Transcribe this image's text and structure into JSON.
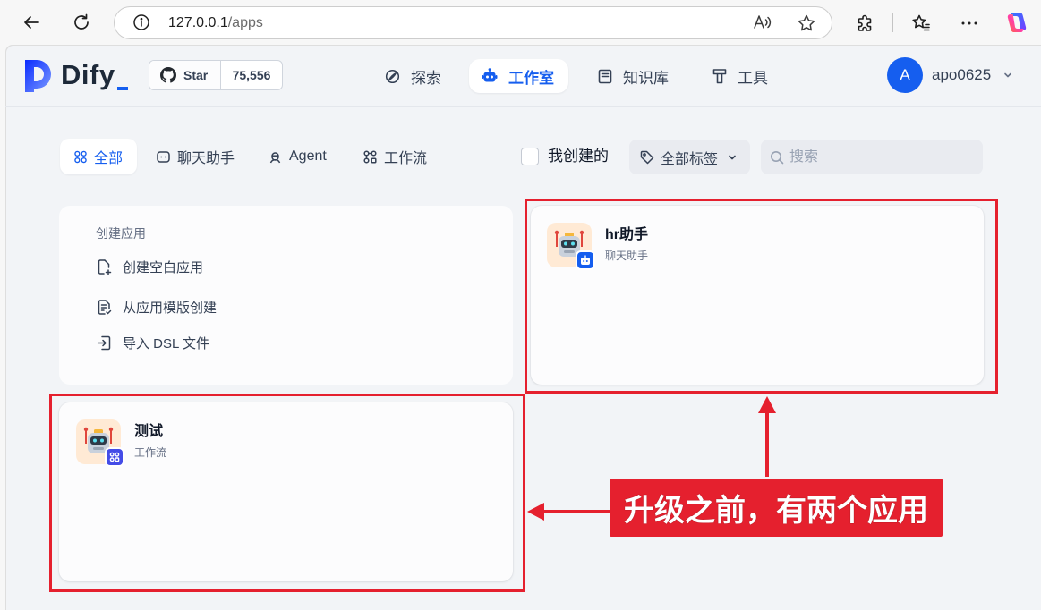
{
  "browser": {
    "url_host": "127.0.0.1",
    "url_path": "/apps",
    "icons": [
      "back-arrow-icon",
      "refresh-icon",
      "site-info-icon",
      "read-aloud-icon",
      "favorite-star-icon",
      "extensions-icon",
      "favorites-icon",
      "more-icon",
      "copilot-icon"
    ]
  },
  "header": {
    "logo": {
      "text": "Dify",
      "underscore": "_"
    },
    "github": {
      "star_label": "Star",
      "star_count": "75,556",
      "icon": "github-icon"
    },
    "nav": [
      {
        "label": "探索",
        "icon": "compass-icon",
        "active": false
      },
      {
        "label": "工作室",
        "icon": "robot-icon",
        "active": true
      },
      {
        "label": "知识库",
        "icon": "book-icon",
        "active": false
      },
      {
        "label": "工具",
        "icon": "tool-icon",
        "active": false
      }
    ],
    "user": {
      "avatar_letter": "A",
      "name": "apo0625"
    }
  },
  "filters": {
    "tabs": [
      {
        "label": "全部",
        "icon": "grid-icon",
        "active": true
      },
      {
        "label": "聊天助手",
        "icon": "chat-icon",
        "active": false
      },
      {
        "label": "Agent",
        "icon": "agent-icon",
        "active": false
      },
      {
        "label": "工作流",
        "icon": "workflow-icon",
        "active": false
      }
    ],
    "created_by_me": {
      "label": "我创建的",
      "checked": false
    },
    "tag_select": {
      "value": "全部标签",
      "icon": "tag-icon"
    },
    "search": {
      "placeholder": "搜索",
      "icon": "search-icon"
    }
  },
  "create_card": {
    "title": "创建应用",
    "actions": [
      {
        "label": "创建空白应用",
        "icon": "file-plus-icon"
      },
      {
        "label": "从应用模版创建",
        "icon": "file-template-icon"
      },
      {
        "label": "导入 DSL 文件",
        "icon": "file-import-icon"
      }
    ]
  },
  "apps": [
    {
      "name": "hr助手",
      "type": "聊天助手",
      "icon": "robot-emoji-icon",
      "badge_icon": "chat-bot-icon",
      "icon_bg": "#ffead5",
      "badge_color": "#155eef"
    },
    {
      "name": "测试",
      "type": "工作流",
      "icon": "robot-emoji-icon",
      "badge_icon": "workflow-icon",
      "icon_bg": "#ffead5",
      "badge_color": "#444ce7"
    }
  ],
  "annotation": {
    "text": "升级之前，有两个应用",
    "color": "#e5202e"
  },
  "colors": {
    "primary": "#155eef",
    "page_bg": "#f2f4f7",
    "text": "#101828",
    "muted": "#667085"
  }
}
